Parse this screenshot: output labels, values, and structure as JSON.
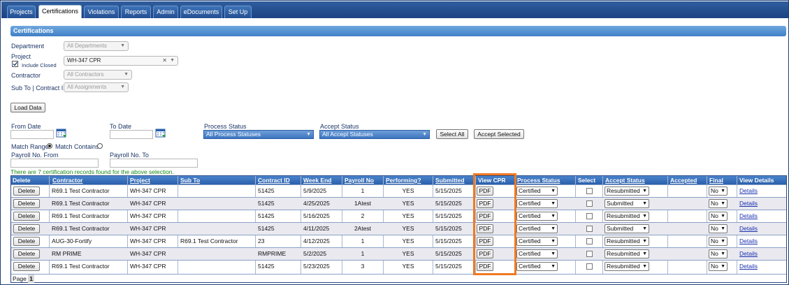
{
  "nav": {
    "tabs": [
      "Projects",
      "Certifications",
      "Violations",
      "Reports",
      "Admin",
      "eDocuments",
      "Set Up"
    ],
    "active": "Certifications"
  },
  "section_title": "Certifications",
  "filters": {
    "department_label": "Department",
    "department_value": "All Departments",
    "project_label": "Project",
    "include_closed_label": "Include Closed",
    "project_value": "WH-347 CPR",
    "contractor_label": "Contractor",
    "contractor_value": "All Contractors",
    "subto_label": "Sub To | Contract ID",
    "subto_value": "All Assignments",
    "load_button": "Load Data",
    "from_date_label": "From Date",
    "to_date_label": "To Date",
    "process_status_label": "Process Status",
    "process_status_value": "All Process Statuses",
    "accept_status_label": "Accept Status",
    "accept_status_value": "All Accept Statuses",
    "select_all_button": "Select All",
    "accept_selected_button": "Accept Selected",
    "match_range_label": "Match Range",
    "match_contains_label": "Match Contains",
    "payroll_from_label": "Payroll No. From",
    "payroll_to_label": "Payroll No. To"
  },
  "found_text": "There are 7 certification records found for the above selection.",
  "table": {
    "headers": [
      "Delete",
      "Contractor",
      "Project",
      "Sub To",
      "Contract ID",
      "Week End",
      "Payroll No",
      "Performing?",
      "Submitted",
      "View CPR",
      "Process Status",
      "Select",
      "Accept Status",
      "Accepted",
      "Final",
      "View Details"
    ],
    "delete_label": "Delete",
    "pdf_label": "PDF",
    "details_label": "Details",
    "rows": [
      {
        "contractor": "R69.1 Test Contractor",
        "project": "WH-347 CPR",
        "subto": "",
        "contract_id": "51425",
        "week_end": "5/9/2025",
        "payroll_no": "1",
        "performing": "YES",
        "submitted": "5/15/2025",
        "process_status": "Certified",
        "accept_status": "Resubmitted",
        "accepted": "",
        "final": "No"
      },
      {
        "contractor": "R69.1 Test Contractor",
        "project": "WH-347 CPR",
        "subto": "",
        "contract_id": "51425",
        "week_end": "4/25/2025",
        "payroll_no": "1Atest",
        "performing": "YES",
        "submitted": "5/15/2025",
        "process_status": "Certified",
        "accept_status": "Submitted",
        "accepted": "",
        "final": "No"
      },
      {
        "contractor": "R69.1 Test Contractor",
        "project": "WH-347 CPR",
        "subto": "",
        "contract_id": "51425",
        "week_end": "5/16/2025",
        "payroll_no": "2",
        "performing": "YES",
        "submitted": "5/15/2025",
        "process_status": "Certified",
        "accept_status": "Resubmitted",
        "accepted": "",
        "final": "No"
      },
      {
        "contractor": "R69.1 Test Contractor",
        "project": "WH-347 CPR",
        "subto": "",
        "contract_id": "51425",
        "week_end": "4/11/2025",
        "payroll_no": "2Atest",
        "performing": "YES",
        "submitted": "5/15/2025",
        "process_status": "Certified",
        "accept_status": "Submitted",
        "accepted": "",
        "final": "No"
      },
      {
        "contractor": "AUG-30-Fortify",
        "project": "WH-347 CPR",
        "subto": "R69.1 Test Contractor",
        "contract_id": "23",
        "week_end": "4/12/2025",
        "payroll_no": "1",
        "performing": "YES",
        "submitted": "5/15/2025",
        "process_status": "Certified",
        "accept_status": "Resubmitted",
        "accepted": "",
        "final": "No"
      },
      {
        "contractor": "RM PRIME",
        "project": "WH-347 CPR",
        "subto": "",
        "contract_id": "RMPRIME",
        "week_end": "5/2/2025",
        "payroll_no": "1",
        "performing": "YES",
        "submitted": "5/15/2025",
        "process_status": "Certified",
        "accept_status": "Resubmitted",
        "accepted": "",
        "final": "No"
      },
      {
        "contractor": "R69.1 Test Contractor",
        "project": "WH-347 CPR",
        "subto": "",
        "contract_id": "51425",
        "week_end": "5/23/2025",
        "payroll_no": "3",
        "performing": "YES",
        "submitted": "5/15/2025",
        "process_status": "Certified",
        "accept_status": "Resubmitted",
        "accepted": "",
        "final": "No"
      }
    ]
  },
  "footer": {
    "page_label": "Page",
    "page_number": "1"
  },
  "colors": {
    "nav": "#1c4383",
    "header": "#2b5fab",
    "highlight": "#ee7a22",
    "found_text": "#1a8a1a",
    "link": "#1a2fb0"
  }
}
